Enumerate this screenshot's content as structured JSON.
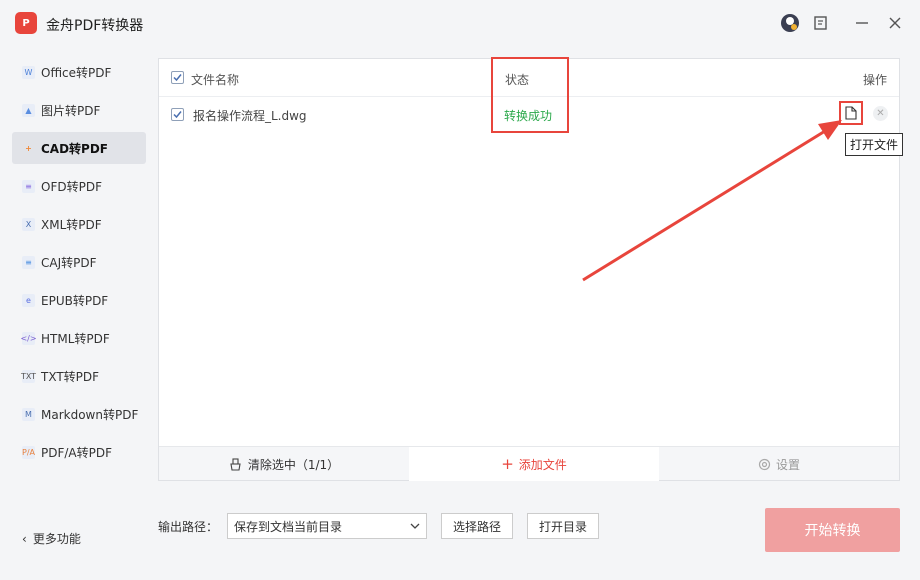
{
  "app": {
    "title": "金舟PDF转换器",
    "logo_text": "P"
  },
  "sidebar": {
    "items": [
      {
        "label": "Office转PDF",
        "icon": "W",
        "color": "#4a7fd8",
        "active": false
      },
      {
        "label": "图片转PDF",
        "icon": "▲",
        "color": "#5a8ee0",
        "active": false
      },
      {
        "label": "CAD转PDF",
        "icon": "+",
        "color": "#f08a3c",
        "active": true
      },
      {
        "label": "OFD转PDF",
        "icon": "≡",
        "color": "#8a6ee0",
        "active": false
      },
      {
        "label": "XML转PDF",
        "icon": "X",
        "color": "#4a6fb0",
        "active": false
      },
      {
        "label": "CAJ转PDF",
        "icon": "≡",
        "color": "#4a8ee0",
        "active": false
      },
      {
        "label": "EPUB转PDF",
        "icon": "e",
        "color": "#5a6ee0",
        "active": false
      },
      {
        "label": "HTML转PDF",
        "icon": "</>",
        "color": "#7a5ed0",
        "active": false
      },
      {
        "label": "TXT转PDF",
        "icon": "TXT",
        "color": "#555555",
        "active": false
      },
      {
        "label": "Markdown转PDF",
        "icon": "M",
        "color": "#4a6fb0",
        "active": false
      },
      {
        "label": "PDF/A转PDF",
        "icon": "P/A",
        "color": "#e8803c",
        "active": false
      }
    ],
    "more_label": "更多功能"
  },
  "table": {
    "col_name": "文件名称",
    "col_status": "状态",
    "col_op": "操作",
    "rows": [
      {
        "name": "报名操作流程_L.dwg",
        "status": "转换成功"
      }
    ],
    "tooltip": "打开文件"
  },
  "footer": {
    "clear_label": "清除选中（1/1）",
    "add_label": "添加文件",
    "settings_label": "设置"
  },
  "bottom": {
    "output_label": "输出路径：",
    "output_value": "保存到文档当前目录",
    "choose_path": "选择路径",
    "open_dir": "打开目录",
    "start": "开始转换"
  },
  "colors": {
    "accent": "#e8453c",
    "success": "#2aa84a",
    "start_disabled": "#f0a0a0"
  }
}
